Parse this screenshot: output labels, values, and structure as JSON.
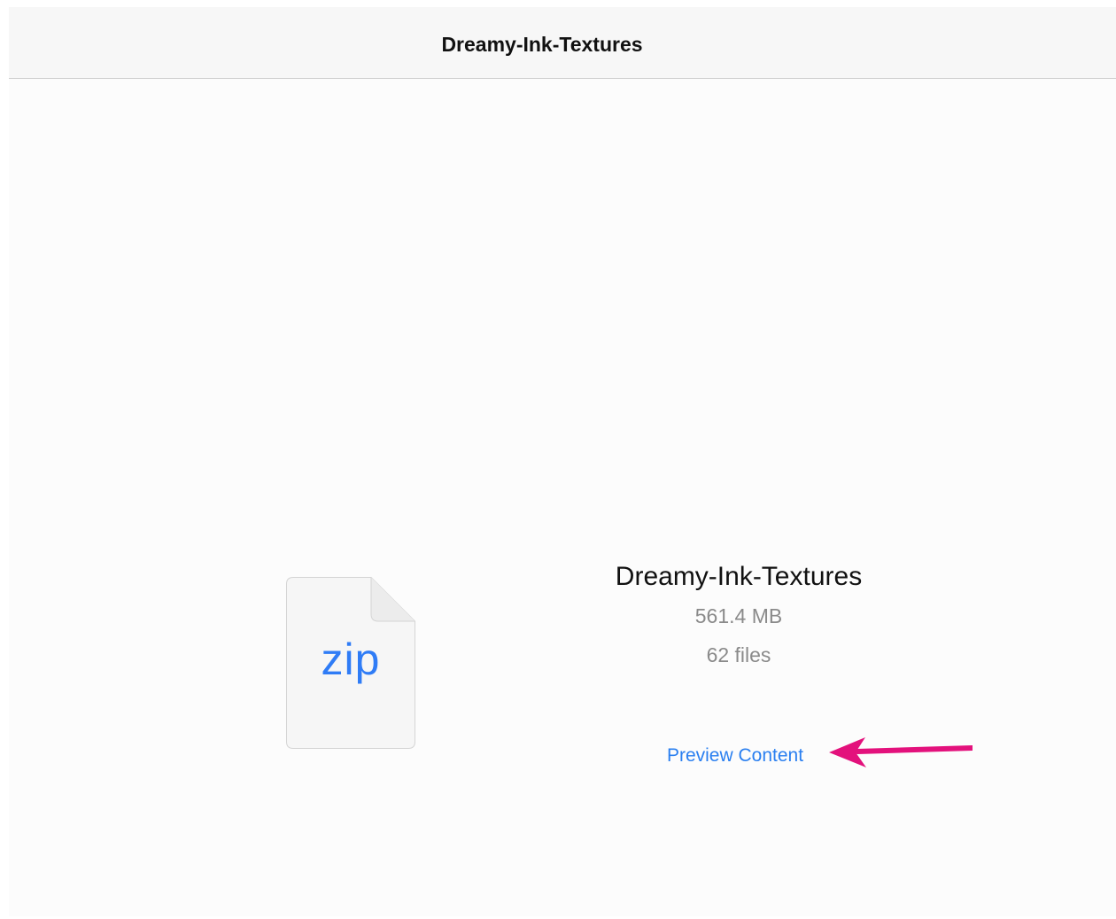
{
  "navbar": {
    "title": "Dreamy-Ink-Textures"
  },
  "file": {
    "icon": "zip-file-icon",
    "extension": "zip",
    "name": "Dreamy-Ink-Textures",
    "size": "561.4 MB",
    "count": "62 files"
  },
  "actions": {
    "preview_label": "Preview Content"
  },
  "annotation": {
    "icon": "arrow-left-icon",
    "color": "#e3117c"
  },
  "colors": {
    "accent": "#2a7ff0",
    "secondary_text": "#8a8a8a"
  }
}
